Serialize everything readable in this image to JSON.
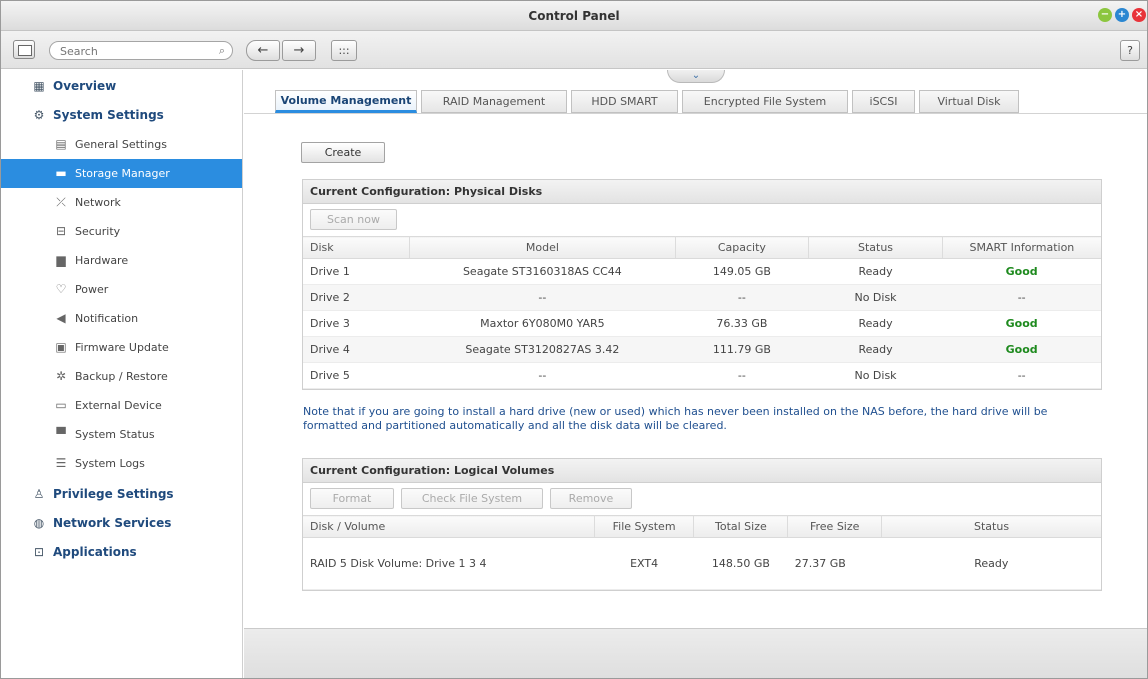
{
  "window": {
    "title": "Control Panel"
  },
  "toolbar": {
    "search_placeholder": "Search",
    "back_label": "←",
    "forward_label": "→",
    "apps_label": ":::",
    "help_label": "?"
  },
  "sidebar": {
    "items": [
      {
        "label": "Overview",
        "icon": "overview-icon"
      },
      {
        "label": "System Settings",
        "icon": "gear-icon"
      },
      {
        "label": "General Settings",
        "icon": "general-settings-icon"
      },
      {
        "label": "Storage Manager",
        "icon": "storage-icon"
      },
      {
        "label": "Network",
        "icon": "network-icon"
      },
      {
        "label": "Security",
        "icon": "lock-icon"
      },
      {
        "label": "Hardware",
        "icon": "hardware-icon"
      },
      {
        "label": "Power",
        "icon": "power-icon"
      },
      {
        "label": "Notification",
        "icon": "notification-icon"
      },
      {
        "label": "Firmware Update",
        "icon": "firmware-icon"
      },
      {
        "label": "Backup / Restore",
        "icon": "backup-icon"
      },
      {
        "label": "External Device",
        "icon": "external-device-icon"
      },
      {
        "label": "System Status",
        "icon": "monitor-icon"
      },
      {
        "label": "System Logs",
        "icon": "logs-icon"
      },
      {
        "label": "Privilege Settings",
        "icon": "user-icon"
      },
      {
        "label": "Network Services",
        "icon": "network-services-icon"
      },
      {
        "label": "Applications",
        "icon": "applications-icon"
      }
    ]
  },
  "tabs": [
    "Volume Management",
    "RAID Management",
    "HDD SMART",
    "Encrypted File System",
    "iSCSI",
    "Virtual Disk"
  ],
  "actions": {
    "create": "Create"
  },
  "physical": {
    "title": "Current Configuration: Physical Disks",
    "scan_button": "Scan now",
    "headers": [
      "Disk",
      "Model",
      "Capacity",
      "Status",
      "SMART Information"
    ],
    "rows": [
      [
        "Drive 1",
        "Seagate ST3160318AS CC44",
        "149.05 GB",
        "Ready",
        "Good"
      ],
      [
        "Drive 2",
        "--",
        "--",
        "No Disk",
        "--"
      ],
      [
        "Drive 3",
        "Maxtor 6Y080M0 YAR5",
        "76.33 GB",
        "Ready",
        "Good"
      ],
      [
        "Drive 4",
        "Seagate ST3120827AS 3.42",
        "111.79 GB",
        "Ready",
        "Good"
      ],
      [
        "Drive 5",
        "--",
        "--",
        "No Disk",
        "--"
      ]
    ]
  },
  "note": "Note that if you are going to install a hard drive (new or used) which has never been installed on the NAS before, the hard drive will be formatted and partitioned automatically and all the disk data will be cleared.",
  "logical": {
    "title": "Current Configuration: Logical Volumes",
    "buttons": {
      "format": "Format",
      "check": "Check File System",
      "remove": "Remove"
    },
    "headers": [
      "Disk / Volume",
      "File System",
      "Total Size",
      "Free Size",
      "Status"
    ],
    "rows": [
      [
        "RAID 5 Disk Volume: Drive 1 3 4",
        "EXT4",
        "148.50 GB",
        "27.37 GB",
        "Ready"
      ]
    ]
  },
  "colors": {
    "accent": "#2b8de0",
    "good": "#1e8a1e",
    "note": "#1f4f8f"
  }
}
